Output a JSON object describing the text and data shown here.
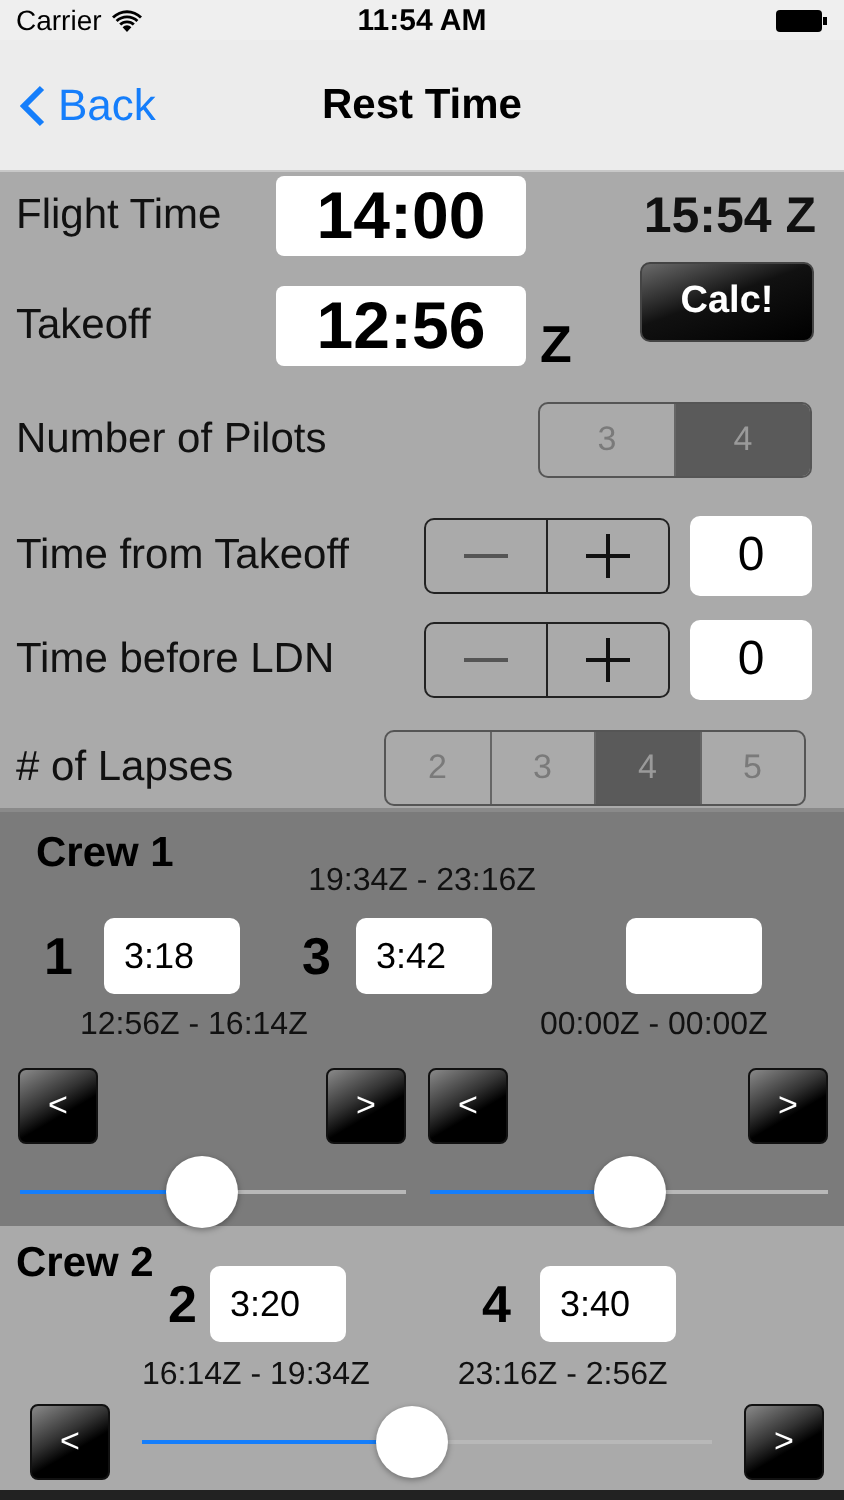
{
  "status_bar": {
    "carrier": "Carrier",
    "time": "11:54 AM"
  },
  "nav": {
    "back": "Back",
    "title": "Rest Time"
  },
  "flight_time": {
    "label": "Flight Time",
    "value": "14:00",
    "landing": "15:54 Z"
  },
  "takeoff": {
    "label": "Takeoff",
    "value": "12:56",
    "suffix": "Z",
    "button": "Calc!"
  },
  "pilots": {
    "label": "Number of Pilots",
    "options": [
      {
        "label": "3",
        "selected": false
      },
      {
        "label": "4",
        "selected": true
      }
    ]
  },
  "steppers": [
    {
      "label": "Time from Takeoff",
      "value": "0"
    },
    {
      "label": "Time before LDN",
      "value": "0"
    }
  ],
  "lapses": {
    "label": "# of Lapses",
    "options": [
      {
        "label": "2",
        "selected": false
      },
      {
        "label": "3",
        "selected": false
      },
      {
        "label": "4",
        "selected": true
      },
      {
        "label": "5",
        "selected": false
      }
    ]
  },
  "crew1": {
    "title": "Crew 1",
    "range_top": "19:34Z - 23:16Z",
    "slots": [
      {
        "number": "1",
        "value": "3:18"
      },
      {
        "number": "3",
        "value": "3:42"
      }
    ],
    "ranges": [
      "12:56Z - 16:14Z",
      "00:00Z - 00:00Z"
    ],
    "sliders": [
      {
        "prev": "<",
        "next": ">",
        "level": 0.47
      },
      {
        "prev": "<",
        "next": ">",
        "level": 0.5
      }
    ]
  },
  "crew2": {
    "title": "Crew 2",
    "slots": [
      {
        "number": "2",
        "value": "3:20"
      },
      {
        "number": "4",
        "value": "3:40"
      }
    ],
    "ranges": [
      "16:14Z - 19:34Z",
      "23:16Z - 2:56Z"
    ],
    "slider": {
      "prev": "<",
      "next": ">",
      "level": 0.475
    }
  }
}
